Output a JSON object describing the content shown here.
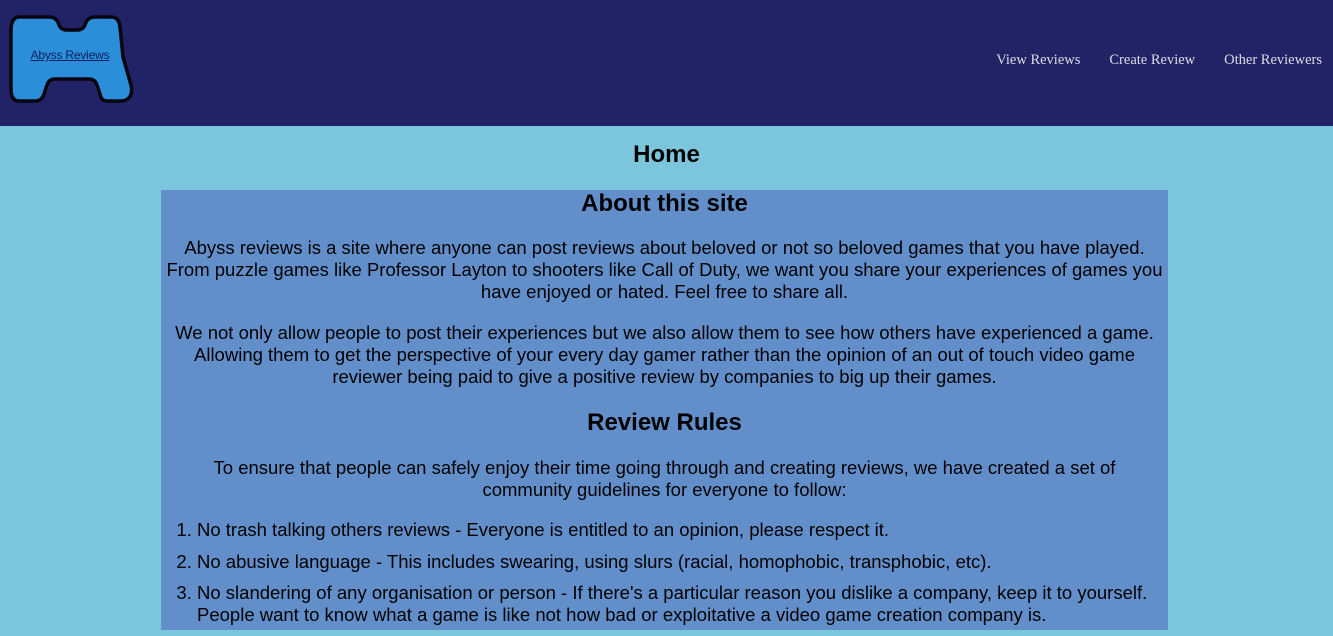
{
  "header": {
    "logo_text": "Abyss Reviews",
    "colors": {
      "bar": "#222266",
      "logo_fill": "#2a8fd8"
    }
  },
  "nav": {
    "items": [
      {
        "label": "View Reviews"
      },
      {
        "label": "Create Review"
      },
      {
        "label": "Other Reviewers"
      }
    ]
  },
  "page": {
    "title": "Home",
    "background": "#7bc6dc",
    "panel_color": "#628fca"
  },
  "about": {
    "heading": "About this site",
    "p1": "Abyss reviews is a site where anyone can post reviews about beloved or not so beloved games that you have played. From puzzle games like Professor Layton to shooters like Call of Duty, we want you share your experiences of games you have enjoyed or hated. Feel free to share all.",
    "p2": "We not only allow people to post their experiences but we also allow them to see how others have experienced a game. Allowing them to get the perspective of your every day gamer rather than the opinion of an out of touch video game reviewer being paid to give a positive review by companies to big up their games."
  },
  "rules": {
    "heading": "Review Rules",
    "intro": "To ensure that people can safely enjoy their time going through and creating reviews, we have created a set of community guidelines for everyone to follow:",
    "items": [
      "No trash talking others reviews - Everyone is entitled to an opinion, please respect it.",
      "No abusive language - This includes swearing, using slurs (racial, homophobic, transphobic, etc).",
      "No slandering of any organisation or person - If there's a particular reason you dislike a company, keep it to yourself. People want to know what a game is like not how bad or exploitative a video game creation company is."
    ]
  }
}
